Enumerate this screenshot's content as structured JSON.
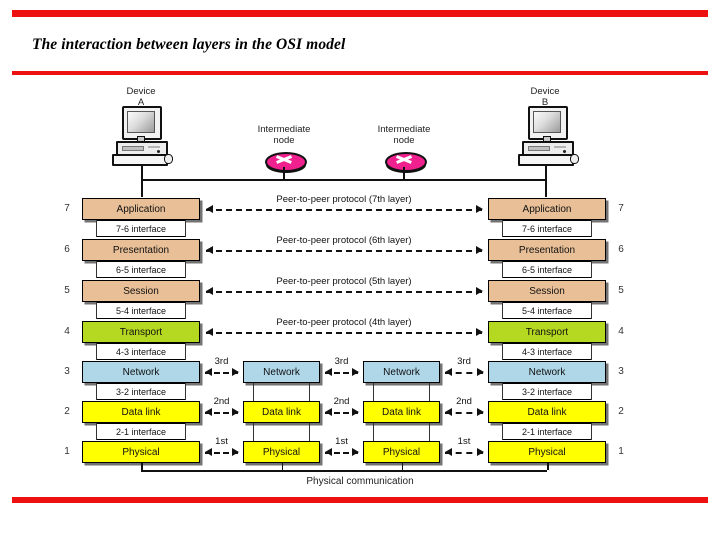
{
  "slide": {
    "title": "The interaction between layers in the OSI model",
    "accent_color": "#ee1111"
  },
  "devices": {
    "left": {
      "label_line1": "Device",
      "label_line2": "A",
      "icon": "desktop-computer-icon"
    },
    "right": {
      "label_line1": "Device",
      "label_line2": "B",
      "icon": "desktop-computer-icon"
    },
    "intermediate_1": {
      "label_line1": "Intermediate",
      "label_line2": "node",
      "icon": "router-icon"
    },
    "intermediate_2": {
      "label_line1": "Intermediate",
      "label_line2": "node",
      "icon": "router-icon"
    }
  },
  "endpoint_stack": {
    "layers": [
      {
        "number": "7",
        "name": "Application",
        "color": "#e8bf97"
      },
      {
        "number": "6",
        "name": "Presentation",
        "color": "#e8bf97"
      },
      {
        "number": "5",
        "name": "Session",
        "color": "#e8bf97"
      },
      {
        "number": "4",
        "name": "Transport",
        "color": "#b5d920"
      },
      {
        "number": "3",
        "name": "Network",
        "color": "#afd7e8"
      },
      {
        "number": "2",
        "name": "Data link",
        "color": "#ffff00"
      },
      {
        "number": "1",
        "name": "Physical",
        "color": "#ffff00"
      }
    ],
    "interfaces": [
      "7-6 interface",
      "6-5 interface",
      "5-4 interface",
      "4-3 interface",
      "3-2 interface",
      "2-1 interface"
    ]
  },
  "intermediate_stack": {
    "layers": [
      {
        "number": "3",
        "name": "Network",
        "color": "#afd7e8"
      },
      {
        "number": "2",
        "name": "Data link",
        "color": "#ffff00"
      },
      {
        "number": "1",
        "name": "Physical",
        "color": "#ffff00"
      }
    ]
  },
  "peer_protocols": [
    "Peer-to-peer protocol (7th layer)",
    "Peer-to-peer protocol (6th layer)",
    "Peer-to-peer protocol (5th layer)",
    "Peer-to-peer protocol (4th layer)"
  ],
  "hop_labels": {
    "network": [
      "3rd",
      "3rd",
      "3rd"
    ],
    "datalink": [
      "2nd",
      "2nd",
      "2nd"
    ],
    "physical": [
      "1st",
      "1st",
      "1st"
    ]
  },
  "footer": {
    "caption": "Physical communication"
  }
}
